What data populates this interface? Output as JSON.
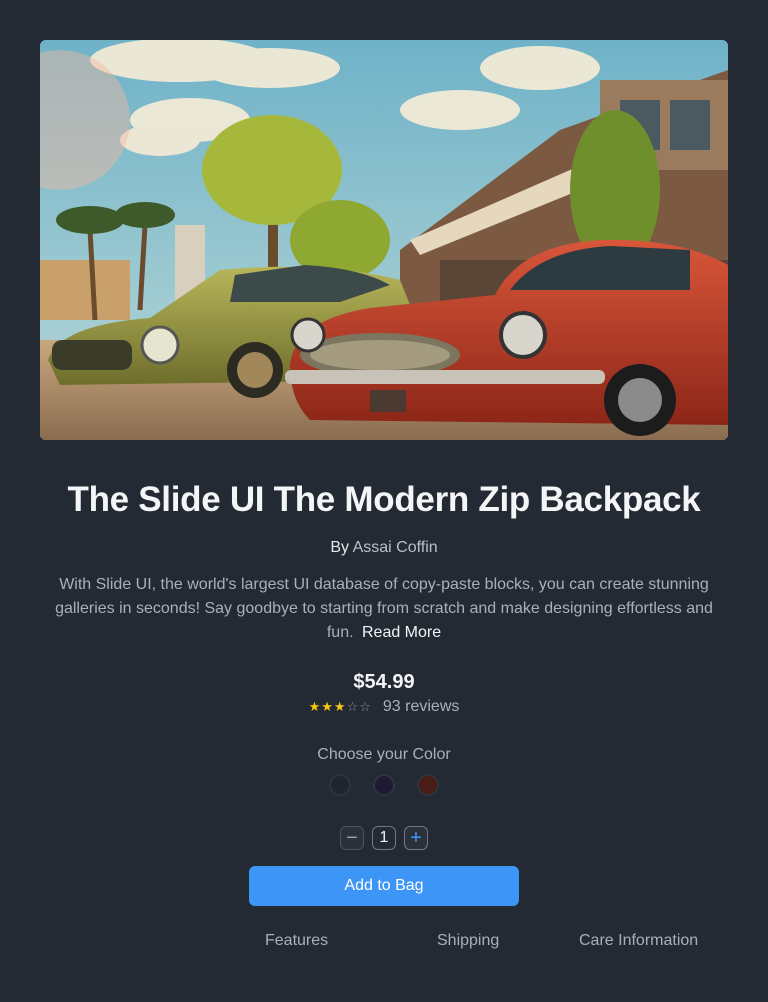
{
  "product": {
    "title": "The Slide UI The Modern Zip Backpack",
    "by_label": "By",
    "author": "Assai Coffin",
    "description": "With Slide UI, the world's largest UI database of copy-paste blocks, you can create stunning galleries in seconds! Say goodbye to starting from scratch and make designing effortless and fun.",
    "read_more": "Read More",
    "price": "$54.99",
    "rating": {
      "value": 3,
      "max": 5,
      "reviews_label": "93 reviews"
    }
  },
  "color_picker": {
    "label": "Choose your Color",
    "options": [
      "#1e252d",
      "#1f1a33",
      "#4a1c16"
    ]
  },
  "quantity": {
    "value": "1",
    "minus_icon": "minus-icon",
    "plus_icon": "plus-icon"
  },
  "actions": {
    "add_to_bag": "Add to Bag"
  },
  "tabs": [
    "Features",
    "Shipping",
    "Care Information"
  ],
  "colors": {
    "background": "#242a33",
    "accent": "#3d96f5",
    "star": "#f5c518"
  }
}
